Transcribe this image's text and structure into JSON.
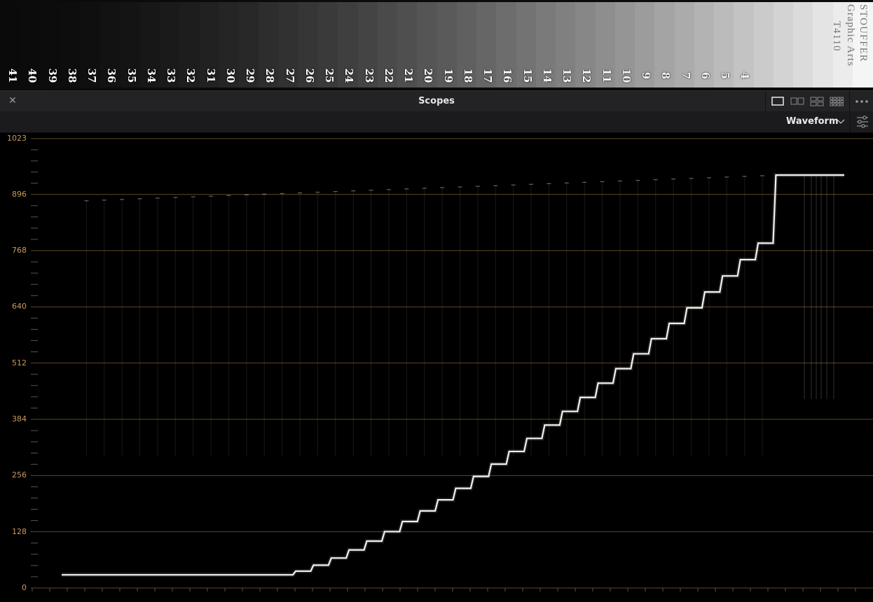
{
  "test_strip": {
    "step_numbers": [
      "41",
      "40",
      "39",
      "38",
      "37",
      "36",
      "35",
      "34",
      "33",
      "32",
      "31",
      "30",
      "29",
      "28",
      "27",
      "26",
      "25",
      "24",
      "23",
      "22",
      "21",
      "20",
      "19",
      "18",
      "17",
      "16",
      "15",
      "14",
      "13",
      "12",
      "11",
      "10",
      "9",
      "8",
      "7",
      "6",
      "5",
      "4"
    ],
    "brand_lines": [
      "STOUFFER",
      "Graphic Arts",
      "T4110"
    ]
  },
  "panel": {
    "close_icon": "close-icon",
    "title": "Scopes",
    "layout_icons": [
      "single-view-icon",
      "dual-view-icon",
      "quad-view-icon",
      "grid-view-icon"
    ],
    "more_icon": "more-options-icon"
  },
  "toolbar": {
    "scope_type": "Waveform",
    "dropdown_icon": "chevron-down-icon",
    "settings_icon": "settings-sliders-icon"
  },
  "scope": {
    "y_labels": [
      "1023",
      "896",
      "768",
      "640",
      "512",
      "384",
      "256",
      "128",
      "0"
    ],
    "grid_color": "#5e4725",
    "label_color": "#c99a5a",
    "trace_color": "#ffffff"
  }
}
